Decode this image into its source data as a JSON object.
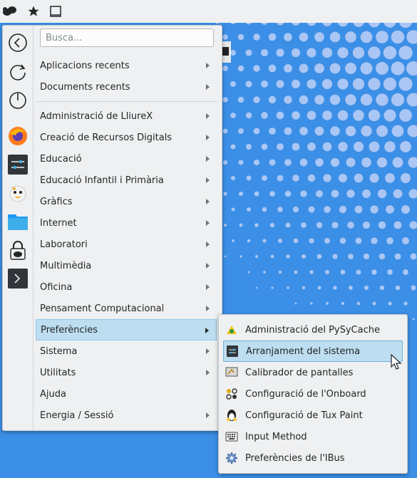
{
  "topbar": {
    "icons": [
      "kde-logo-icon",
      "star-icon",
      "window-icon"
    ]
  },
  "search": {
    "placeholder": "Busca..."
  },
  "favorites": [
    "back-icon",
    "refresh-icon",
    "power-icon",
    "firefox-icon",
    "system-settings-icon",
    "tux-paint-icon",
    "file-manager-icon",
    "lock-icon",
    "terminal-icon"
  ],
  "menu": {
    "items": [
      {
        "label": "Aplicacions recents",
        "submenu": true
      },
      {
        "label": "Documents recents",
        "submenu": true
      },
      {
        "label": "Administració de LliureX",
        "submenu": true
      },
      {
        "label": "Creació de Recursos Digitals",
        "submenu": true
      },
      {
        "label": "Educació",
        "submenu": true
      },
      {
        "label": "Educació Infantil i Primària",
        "submenu": true
      },
      {
        "label": "Gràfics",
        "submenu": true
      },
      {
        "label": "Internet",
        "submenu": true
      },
      {
        "label": "Laboratori",
        "submenu": true
      },
      {
        "label": "Multimèdia",
        "submenu": true
      },
      {
        "label": "Oficina",
        "submenu": true
      },
      {
        "label": "Pensament Computacional",
        "submenu": true
      },
      {
        "label": "Preferències",
        "submenu": true,
        "selected": true
      },
      {
        "label": "Sistema",
        "submenu": true
      },
      {
        "label": "Utilitats",
        "submenu": true
      },
      {
        "label": "Ajuda",
        "submenu": false
      },
      {
        "label": "Energia / Sessió",
        "submenu": true
      }
    ]
  },
  "submenu": {
    "items": [
      {
        "label": "Administració del PySyCache",
        "icon": "pysycache-icon"
      },
      {
        "label": "Arranjament del sistema",
        "icon": "system-settings-icon",
        "selected": true
      },
      {
        "label": "Calibrador de pantalles",
        "icon": "screen-calibrator-icon"
      },
      {
        "label": "Configuració de l'Onboard",
        "icon": "onboard-icon"
      },
      {
        "label": "Configuració de Tux Paint",
        "icon": "tux-paint-config-icon"
      },
      {
        "label": "Input Method",
        "icon": "keyboard-icon"
      },
      {
        "label": "Preferències de l'IBus",
        "icon": "ibus-gear-icon"
      }
    ]
  },
  "colors": {
    "wallpaper": "#3b8fe6",
    "wallpaper_dots": "#aac6f4",
    "selection": "#bdddf0",
    "menu_bg": "#eff0f1"
  }
}
